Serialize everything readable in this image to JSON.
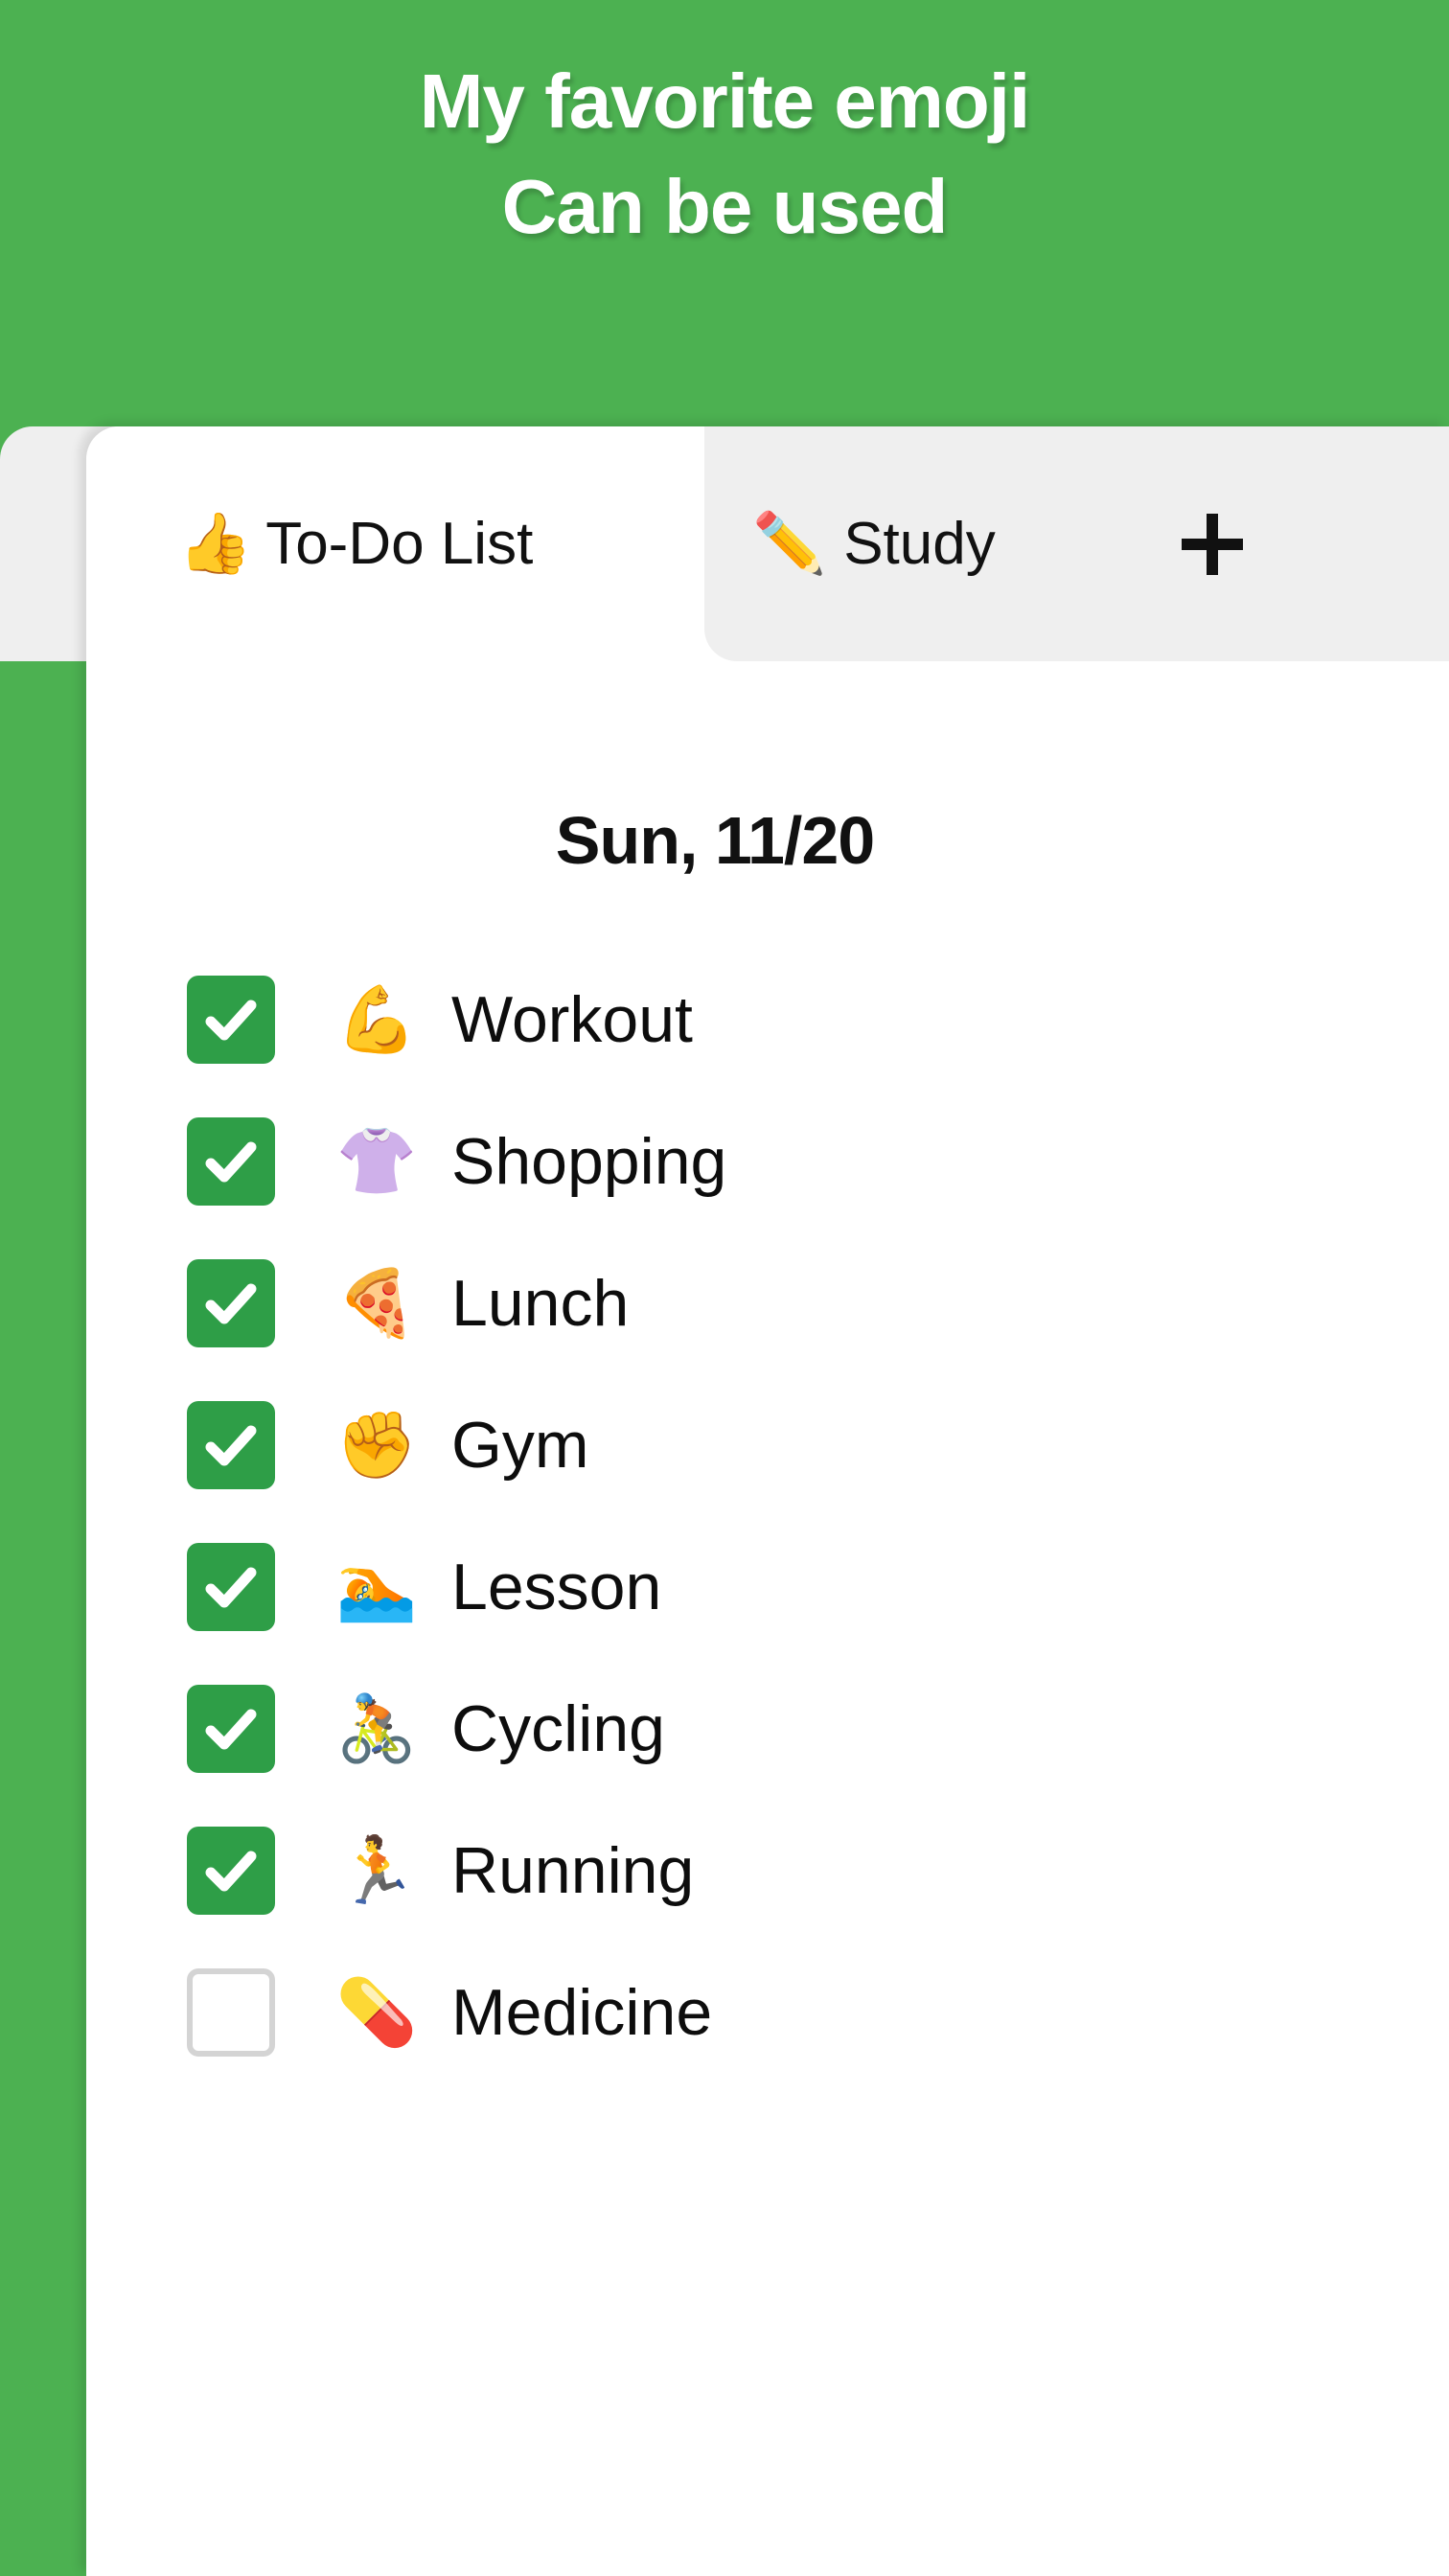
{
  "hero": {
    "line1": "My favorite emoji",
    "line2": "Can be used",
    "background_color": "#4CB151",
    "text_color": "#FFFFFF"
  },
  "tabs": {
    "active_index": 0,
    "items": [
      {
        "emoji": "👍",
        "emoji_name": "thumbs-up-emoji",
        "label": "To-Do List",
        "active": true
      },
      {
        "emoji": "✏️",
        "emoji_name": "pencil-emoji",
        "label": "Study",
        "active": false
      }
    ],
    "add_button_label": "+",
    "inactive_background": "#EFEFEF",
    "active_background": "#FFFFFF"
  },
  "main": {
    "date_header": "Sun, 11/20",
    "checkbox_checked_color": "#2E9E47",
    "checkbox_unchecked_border": "#D4D4D4",
    "tasks": [
      {
        "checked": true,
        "emoji": "💪",
        "emoji_name": "flexed-biceps-emoji",
        "label": "Workout"
      },
      {
        "checked": true,
        "emoji": "👚",
        "emoji_name": "womans-clothes-emoji",
        "label": "Shopping"
      },
      {
        "checked": true,
        "emoji": "🍕",
        "emoji_name": "pizza-emoji",
        "label": "Lunch"
      },
      {
        "checked": true,
        "emoji": "✊",
        "emoji_name": "raised-fist-emoji",
        "label": "Gym"
      },
      {
        "checked": true,
        "emoji": "🏊",
        "emoji_name": "swimmer-emoji",
        "label": "Lesson"
      },
      {
        "checked": true,
        "emoji": "🚴",
        "emoji_name": "cyclist-emoji",
        "label": "Cycling"
      },
      {
        "checked": true,
        "emoji": "🏃",
        "emoji_name": "runner-emoji",
        "label": "Running"
      },
      {
        "checked": false,
        "emoji": "💊",
        "emoji_name": "pill-emoji",
        "label": "Medicine"
      }
    ]
  }
}
